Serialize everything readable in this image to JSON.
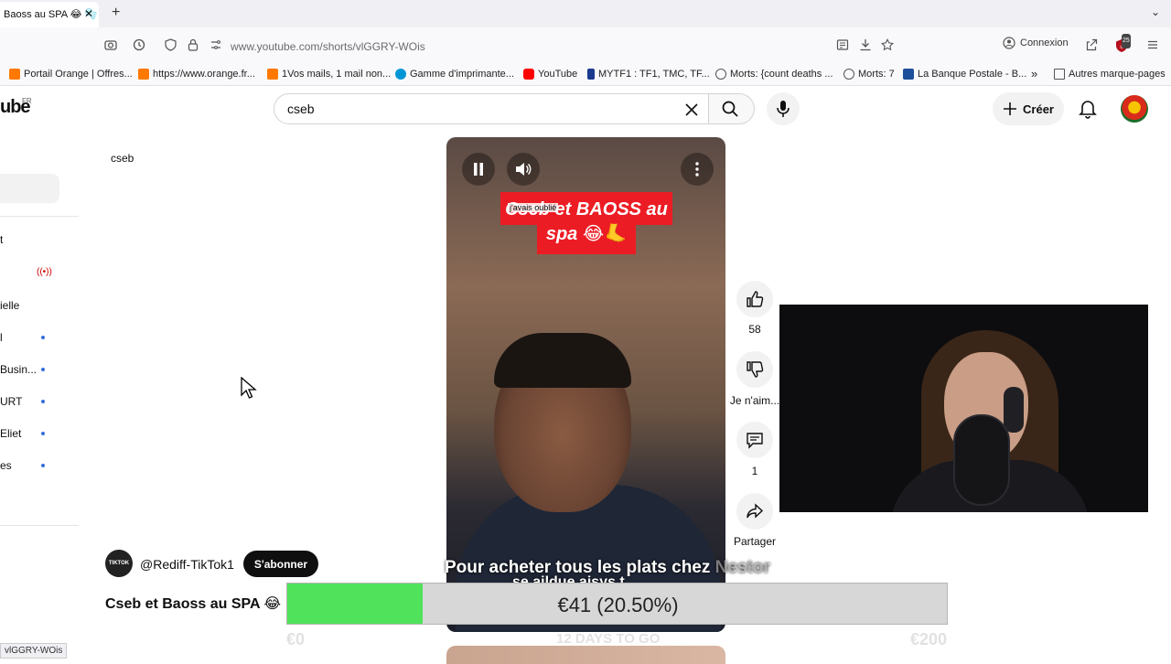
{
  "browser": {
    "tab_title": "Baoss au SPA 😂 🫧",
    "tab_close": "✕",
    "new_tab": "+",
    "tab_list": "⌄",
    "url": "www.youtube.com/shorts/vlGGRY-WOis",
    "connexion_label": "Connexion",
    "extension_badge": "25",
    "bookmarks": [
      {
        "label": "Portail Orange | Offres...",
        "color": "#ff7900"
      },
      {
        "label": "https://www.orange.fr...",
        "color": "#ff7900"
      },
      {
        "label": "1Vos mails, 1 mail non...",
        "color": "#ff7900"
      },
      {
        "label": "Gamme d'imprimante...",
        "color": "#0096d6"
      },
      {
        "label": "YouTube",
        "color": "#ff0000"
      },
      {
        "label": "MYTF1 : TF1, TMC, TF...",
        "color": "#1a3a8f"
      },
      {
        "label": "Morts: {count deaths ...",
        "color": "#555555"
      },
      {
        "label": "Morts: 7",
        "color": "#555555"
      },
      {
        "label": "La Banque Postale - B...",
        "color": "#1d4f9a"
      }
    ],
    "bookmarks_more": "»",
    "other_bookmarks": "Autres marque-pages",
    "status_url": "vlGGRY-WOis"
  },
  "youtube": {
    "logo_text": "ube",
    "logo_region": "FR",
    "search_value": "cseb",
    "create_label": "Créer",
    "sidebar": {
      "search_chip": "cseb",
      "items": [
        "t",
        "ielle",
        "l",
        "Busin...",
        "URT",
        "Eliet",
        "es"
      ]
    },
    "video": {
      "caption": "Cseb et BAOSS au spa 😂🦶",
      "caption_sticker": "j'avais oublié",
      "subtitle_main": "Pour acheter tous les plats chez ",
      "subtitle_ghost": "Nestor",
      "subtitle_line2": "se aildue aisys t"
    },
    "actions": {
      "likes": "58",
      "dislike_label": "Je n'aim...",
      "comments": "1",
      "share_label": "Partager"
    },
    "channel_name": "@Rediff-TikTok1",
    "channel_avatar_text": "TIKTOK",
    "subscribe_label": "S'abonner",
    "short_title": "Cseb et Baoss au SPA 😂"
  },
  "donation_goal": {
    "amount_text": "€41 (20.50%)",
    "progress_fraction": 0.205,
    "start_label": "€0",
    "days_label": "12 DAYS TO GO",
    "end_label": "€200",
    "fill_color": "#4fe25a"
  }
}
